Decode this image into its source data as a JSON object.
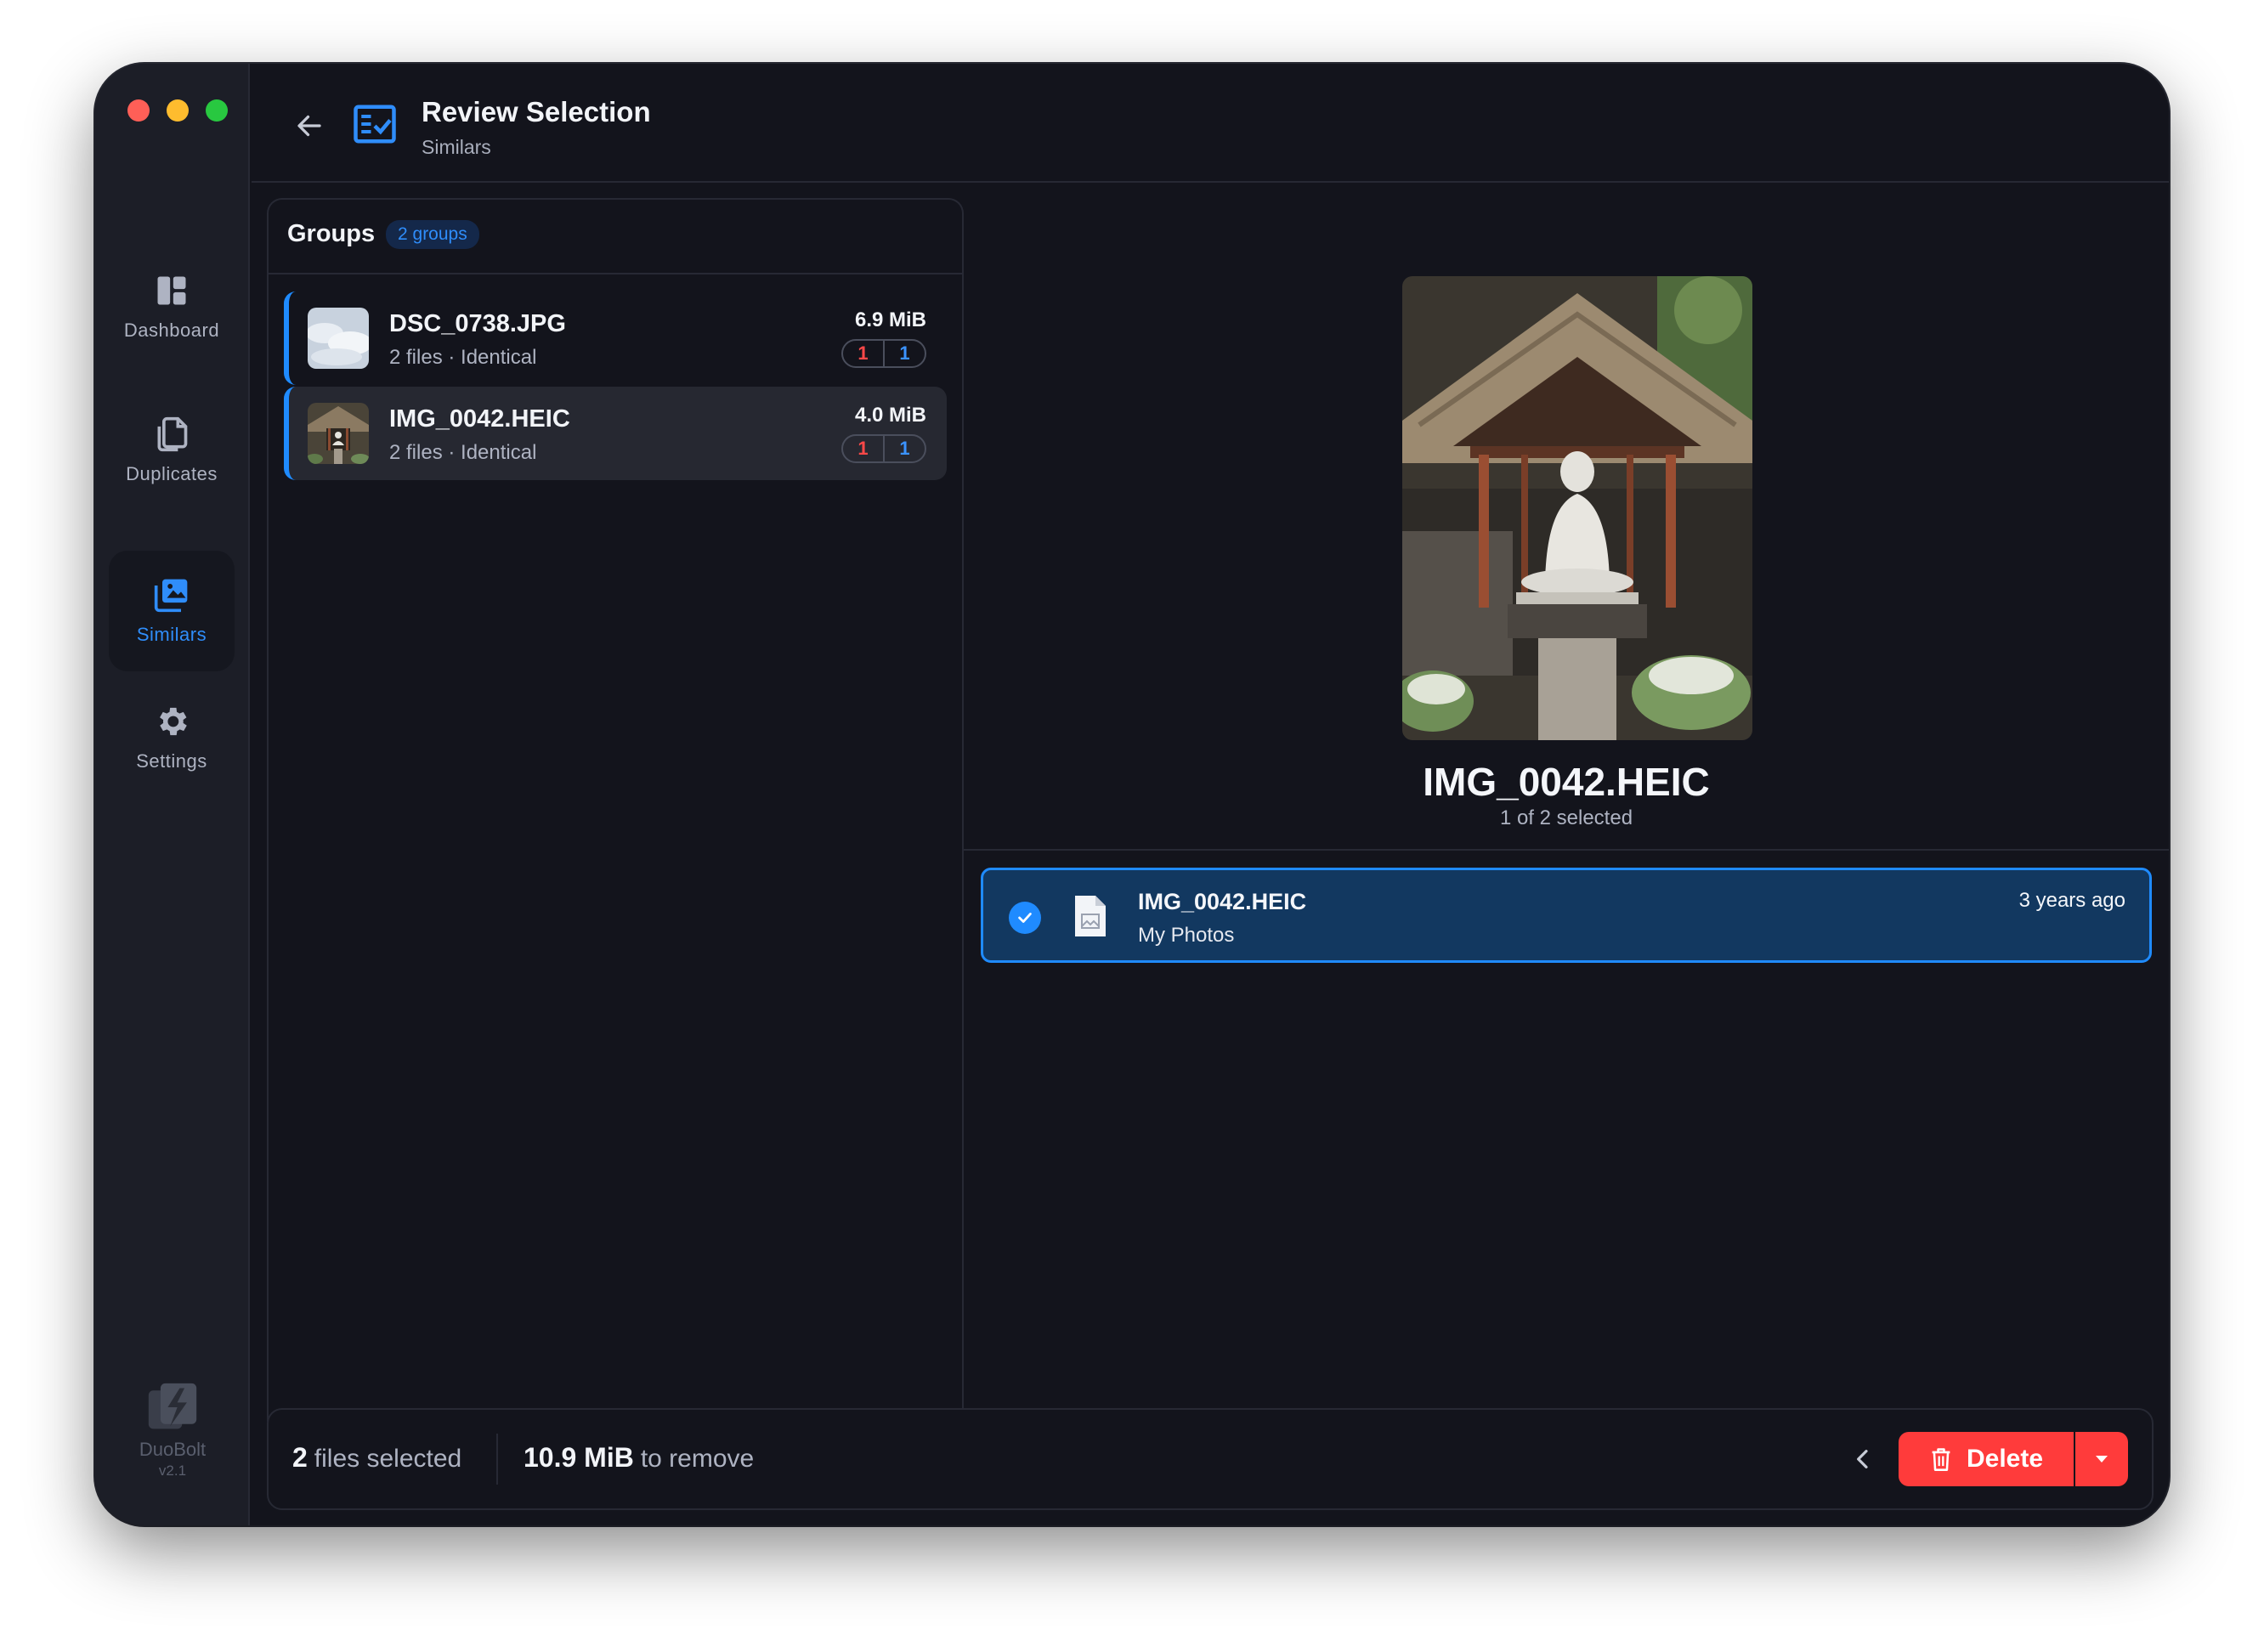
{
  "window": {
    "traffic_lights": [
      "close",
      "minimize",
      "zoom"
    ]
  },
  "sidebar": {
    "items": [
      {
        "label": "Dashboard",
        "icon": "dashboard-icon",
        "active": false
      },
      {
        "label": "Duplicates",
        "icon": "duplicates-icon",
        "active": false
      },
      {
        "label": "Similars",
        "icon": "similars-icon",
        "active": true
      },
      {
        "label": "Settings",
        "icon": "gear-icon",
        "active": false
      }
    ],
    "brand": {
      "name": "DuoBolt",
      "version": "v2.1"
    }
  },
  "header": {
    "title": "Review Selection",
    "subtitle": "Similars"
  },
  "groups": {
    "title": "Groups",
    "count_badge": "2 groups",
    "items": [
      {
        "name": "DSC_0738.JPG",
        "meta": "2 files · Identical",
        "size": "6.9 MiB",
        "red_count": "1",
        "blue_count": "1",
        "selected": false
      },
      {
        "name": "IMG_0042.HEIC",
        "meta": "2 files · Identical",
        "size": "4.0 MiB",
        "red_count": "1",
        "blue_count": "1",
        "selected": true
      }
    ]
  },
  "preview": {
    "name": "IMG_0042.HEIC",
    "selection": "1 of 2 selected",
    "files": [
      {
        "name": "IMG_0042.HEIC",
        "location": "My Photos",
        "age": "3 years ago",
        "checked": true
      }
    ]
  },
  "footer": {
    "files_count": "2",
    "files_label": "files selected",
    "size_value": "10.9 MiB",
    "size_label": "to remove",
    "delete_label": "Delete"
  },
  "colors": {
    "accent": "#1f8bff",
    "danger": "#ff3b3b",
    "background": "#13141c",
    "sidebar": "#1c1e27"
  }
}
